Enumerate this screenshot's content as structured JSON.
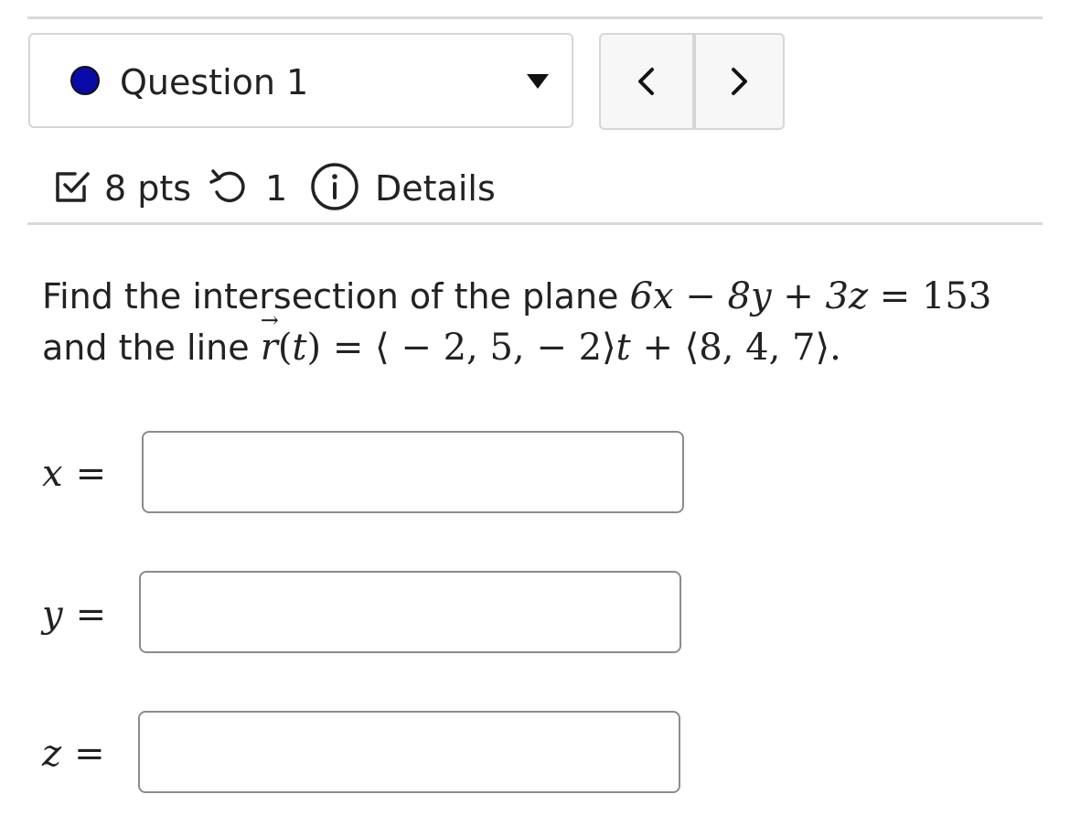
{
  "question": {
    "label": "Question 1",
    "status_color": "#0a0aa8"
  },
  "nav": {
    "prev_icon": "chevron-left-icon",
    "next_icon": "chevron-right-icon"
  },
  "meta": {
    "points": "8 pts",
    "attempts": "1",
    "details": "Details"
  },
  "problem": {
    "line1_prefix": "Find the intersection of the plane",
    "plane_equation": "6x − 8y + 3z = 153",
    "line2_prefix": "and the line",
    "line_equation": "r(t) = ⟨ − 2, 5,  − 2⟩t + ⟨8, 4, 7⟩."
  },
  "answers": [
    {
      "var": "x",
      "eq": "=",
      "value": ""
    },
    {
      "var": "y",
      "eq": "=",
      "value": ""
    },
    {
      "var": "z",
      "eq": "=",
      "value": ""
    }
  ]
}
